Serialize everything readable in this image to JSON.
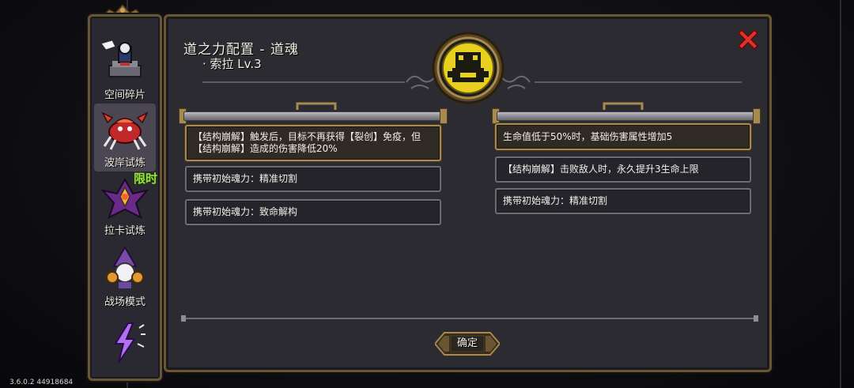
{
  "sidebar": {
    "items": [
      {
        "label": "空间碎片",
        "icon": "space-fragment-icon"
      },
      {
        "label": "波岸试炼",
        "icon": "crab-boss-icon",
        "active": true
      },
      {
        "label": "拉卡试炼",
        "icon": "laka-trial-icon",
        "badge": "限时"
      },
      {
        "label": "战场模式",
        "icon": "battlefield-mode-icon"
      },
      {
        "label": "",
        "icon": "lightning-mode-icon"
      }
    ]
  },
  "panel": {
    "title": "道之力配置 - 道魂",
    "subtitle": "· 索拉 Lv.3",
    "emblem_icon": "sola-soul-emblem-icon",
    "close_icon": "close-icon",
    "left_entries": [
      {
        "text": "【结构崩解】触发后，目标不再获得【裂创】免疫，但【结构崩解】造成的伤害降低20%",
        "highlight": true
      },
      {
        "text": "携带初始魂力：精准切割",
        "highlight": false
      },
      {
        "text": "携带初始魂力：致命解构",
        "highlight": false
      }
    ],
    "right_entries": [
      {
        "text": "生命值低于50%时，基础伤害属性增加5",
        "highlight": true
      },
      {
        "text": "【结构崩解】击败敌人时，永久提升3生命上限",
        "highlight": false
      },
      {
        "text": "携带初始魂力：精准切割",
        "highlight": false
      }
    ],
    "confirm_label": "确定"
  },
  "version": "3.6.0.2 44918684",
  "colors": {
    "panel_bg": "#2c2b31",
    "frame_gold": "#6b5634",
    "highlight_border": "#a88a4f",
    "close_red": "#e0302a",
    "badge_green": "#9be040",
    "emblem_yellow": "#e8d020"
  }
}
